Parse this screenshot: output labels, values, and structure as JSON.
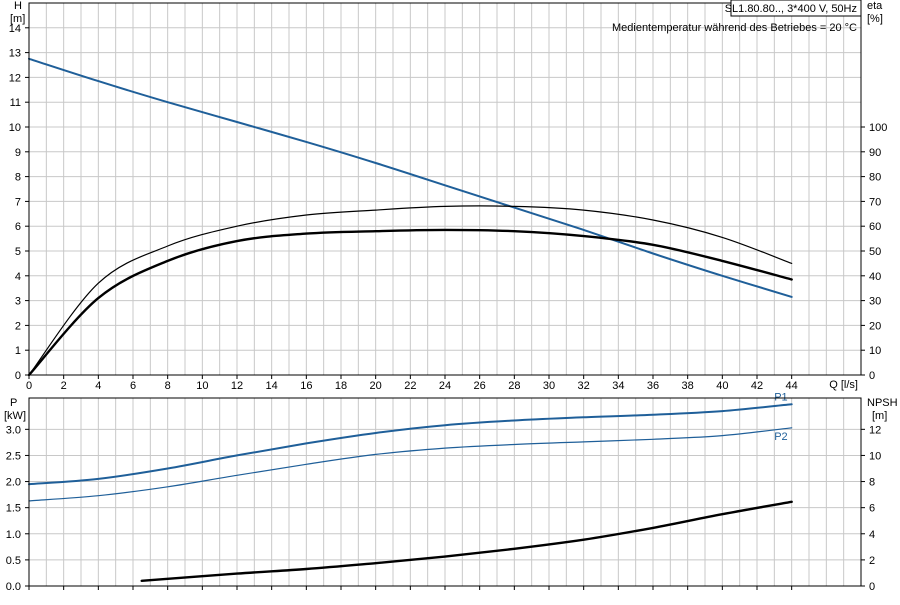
{
  "header": {
    "model": "SL1.80.80.., 3*400 V, 50Hz",
    "condition": "Medientemperatur während des Betriebes = 20 °C"
  },
  "top_axes": {
    "left_label": "H",
    "left_unit": "[m]",
    "right_label": "eta",
    "right_unit": "[%]",
    "x_label": "Q [l/s]"
  },
  "bottom_axes": {
    "left_label": "P",
    "left_unit": "[kW]",
    "right_label": "NPSH",
    "right_unit": "[m]"
  },
  "chart_data": [
    {
      "type": "line",
      "x": [
        0,
        4,
        8,
        12,
        16,
        20,
        24,
        28,
        32,
        36,
        40,
        44
      ],
      "xlim": [
        0,
        48
      ],
      "xticks": [
        0,
        2,
        4,
        6,
        8,
        10,
        12,
        14,
        16,
        18,
        20,
        22,
        24,
        26,
        28,
        30,
        32,
        34,
        36,
        38,
        40,
        42,
        44
      ],
      "ylim": [
        0,
        15
      ],
      "yticks": [
        0,
        1,
        2,
        3,
        4,
        5,
        6,
        7,
        8,
        9,
        10,
        11,
        12,
        13,
        14
      ],
      "y2lim": [
        0,
        150
      ],
      "y2ticks": [
        0,
        10,
        20,
        30,
        40,
        50,
        60,
        70,
        80,
        90,
        100
      ],
      "grid": true,
      "series": [
        {
          "key": "head",
          "axis": "left",
          "color": "#1f5f99",
          "values": [
            12.75,
            11.85,
            11.0,
            10.2,
            9.4,
            8.55,
            7.65,
            6.75,
            5.85,
            4.9,
            4.0,
            3.15
          ]
        },
        {
          "key": "eta_total",
          "axis": "right",
          "color": "#000000",
          "values": [
            0,
            31,
            46,
            54,
            57,
            58,
            58.5,
            58,
            56,
            52.5,
            46,
            38.5
          ]
        },
        {
          "key": "eta_hydraulic",
          "axis": "right",
          "color": "#000000",
          "values": [
            0,
            37,
            52,
            60,
            64.5,
            66.5,
            68,
            68,
            66.5,
            62.5,
            55.5,
            45
          ]
        }
      ]
    },
    {
      "type": "line",
      "x": [
        0,
        4,
        8,
        12,
        16,
        20,
        24,
        28,
        32,
        36,
        40,
        44
      ],
      "xlim": [
        0,
        48
      ],
      "xticks": [
        0,
        2,
        4,
        6,
        8,
        10,
        12,
        14,
        16,
        18,
        20,
        22,
        24,
        26,
        28,
        30,
        32,
        34,
        36,
        38,
        40,
        42,
        44
      ],
      "ylim": [
        0,
        3.6
      ],
      "yticks": [
        0,
        0.5,
        1.0,
        1.5,
        2.0,
        2.5,
        3.0
      ],
      "ytick_labels": [
        "0.0",
        "0.5",
        "1.0",
        "1.5",
        "2.0",
        "2.5",
        "3.0"
      ],
      "y2lim": [
        0,
        14.4
      ],
      "y2ticks": [
        0,
        2,
        4,
        6,
        8,
        10,
        12
      ],
      "grid": true,
      "series": [
        {
          "name": "P1",
          "axis": "left",
          "color": "#1f5f99",
          "values": [
            1.95,
            2.05,
            2.25,
            2.5,
            2.73,
            2.93,
            3.08,
            3.17,
            3.23,
            3.28,
            3.35,
            3.48
          ]
        },
        {
          "name": "P2",
          "axis": "left",
          "color": "#1f5f99",
          "values": [
            1.63,
            1.73,
            1.9,
            2.12,
            2.33,
            2.52,
            2.64,
            2.71,
            2.76,
            2.81,
            2.88,
            3.03
          ]
        },
        {
          "key": "npsh",
          "axis": "right",
          "color": "#000000",
          "x": [
            6.5,
            12,
            16,
            20,
            24,
            28,
            32,
            36,
            40,
            44
          ],
          "values": [
            0.4,
            0.95,
            1.3,
            1.75,
            2.25,
            2.85,
            3.55,
            4.45,
            5.5,
            6.45
          ]
        }
      ]
    }
  ]
}
